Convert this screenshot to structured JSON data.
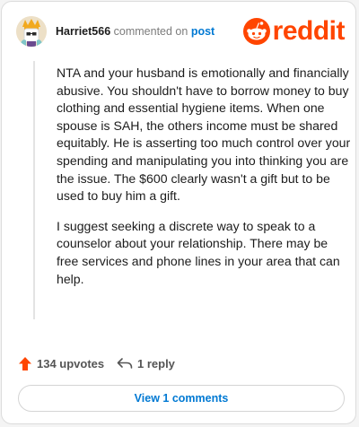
{
  "comment": {
    "username": "Harriet566",
    "action_text": "commented on",
    "target_link": "post",
    "paragraphs": [
      "NTA and your husband is emotionally and financially abusive. You shouldn't have to borrow money to buy clothing and essential hygiene items. When one spouse is SAH, the others income must be shared equitably. He is asserting too much control over your spending and manipulating you into thinking you are the issue. The $600 clearly wasn't a gift but to be used to buy him a gift.",
      "I suggest seeking a discrete way to speak to a counselor about your relationship. There may be free services and phone lines in your area that can help."
    ]
  },
  "brand": {
    "name": "reddit",
    "color": "#ff4500",
    "icon": "reddit-alien-icon"
  },
  "actions": {
    "upvotes_label": "134 upvotes",
    "reply_label": "1 reply",
    "upvote_icon": "upvote-arrow-icon",
    "reply_icon": "reply-arrow-icon"
  },
  "view_comments_label": "View 1 comments",
  "colors": {
    "accent": "#ff4500",
    "link": "#0079d3"
  }
}
